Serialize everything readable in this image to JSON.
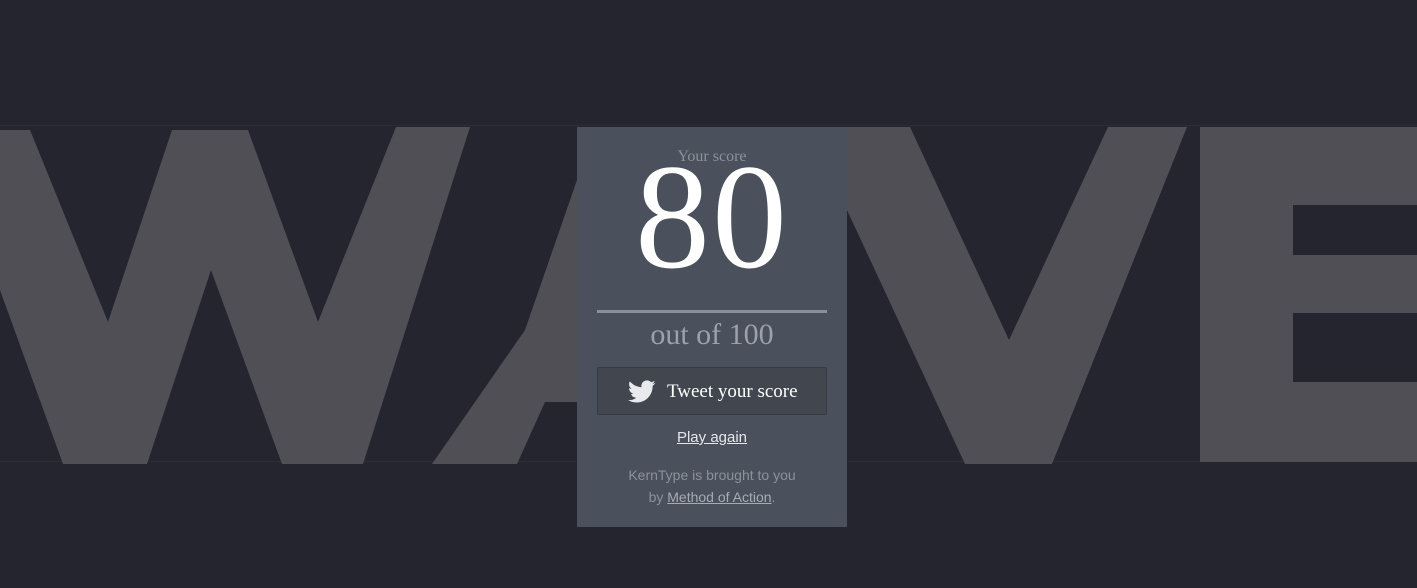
{
  "background_word": "WAVE",
  "colors": {
    "background": "#252530",
    "letters": "#4f4f55",
    "card": "#4a505c",
    "score": "#ffffff",
    "muted": "#8d919a"
  },
  "card": {
    "score_label": "Your score",
    "score_value": "80",
    "out_of": "out of 100",
    "tweet_label": "Tweet your score",
    "tweet_icon": "twitter-bird-icon",
    "play_again": "Play again",
    "credit_line1": "KernType is brought to you",
    "credit_by": "by ",
    "credit_link": "Method of Action",
    "credit_end": "."
  }
}
